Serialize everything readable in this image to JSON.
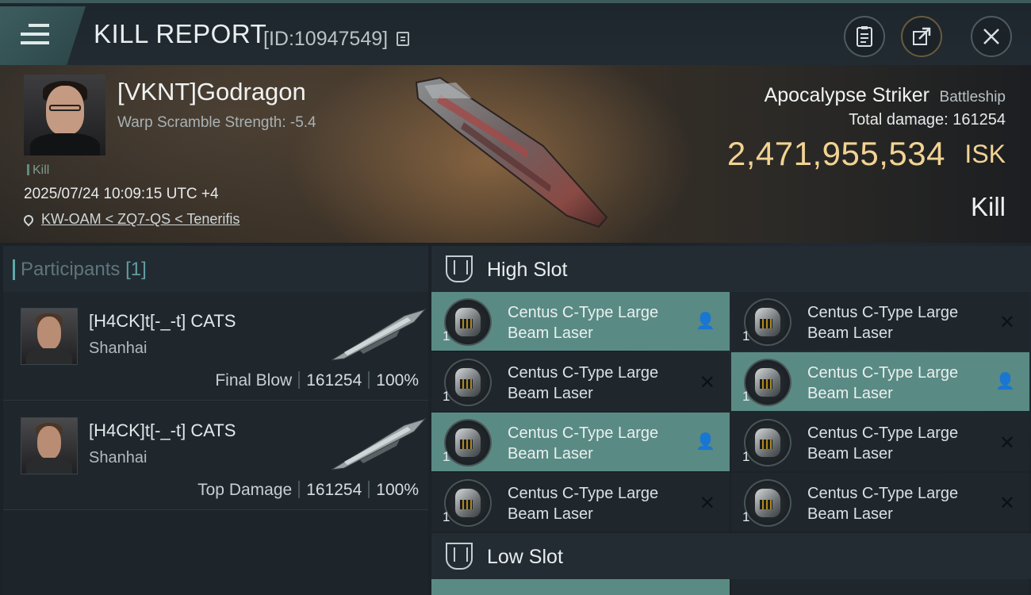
{
  "header": {
    "title": "KILL REPORT",
    "report_id": "[ID:10947549]"
  },
  "victim": {
    "name": "[VKNT]Godragon",
    "warp_scramble": "Warp Scramble Strength: -5.4",
    "type_tag": "Kill",
    "datetime": "2025/07/24 10:09:15 UTC +4",
    "location": "KW-OAM < ZQ7-QS < Tenerifis",
    "ship_name": "Apocalypse Striker",
    "ship_class": "Battleship",
    "total_damage": "Total damage:  161254",
    "isk_value": "2,471,955,534",
    "isk_unit": "ISK",
    "status": "Kill"
  },
  "participants": {
    "label": "Participants",
    "count": "[1]",
    "rows": [
      {
        "name": "[H4CK]t[-_-t] CATS",
        "corp": "Shanhai",
        "role": "Final Blow",
        "damage": "161254",
        "percent": "100%"
      },
      {
        "name": "[H4CK]t[-_-t] CATS",
        "corp": "Shanhai",
        "role": "Top Damage",
        "damage": "161254",
        "percent": "100%"
      }
    ]
  },
  "slots": {
    "high_label": "High Slot",
    "low_label": "Low Slot",
    "modules": [
      {
        "name_line1": "Centus C-Type Large",
        "name_line2": "Beam Laser",
        "qty": "1",
        "highlighted": true,
        "status_icon": "person-icon"
      },
      {
        "name_line1": "Centus C-Type Large",
        "name_line2": "Beam Laser",
        "qty": "1",
        "highlighted": false,
        "status_icon": "destroyed-x-icon"
      },
      {
        "name_line1": "Centus C-Type Large",
        "name_line2": "Beam Laser",
        "qty": "1",
        "highlighted": false,
        "status_icon": "destroyed-x-icon"
      },
      {
        "name_line1": "Centus C-Type Large",
        "name_line2": "Beam Laser",
        "qty": "1",
        "highlighted": true,
        "status_icon": "person-icon"
      },
      {
        "name_line1": "Centus C-Type Large",
        "name_line2": "Beam Laser",
        "qty": "1",
        "highlighted": true,
        "status_icon": "person-icon"
      },
      {
        "name_line1": "Centus C-Type Large",
        "name_line2": "Beam Laser",
        "qty": "1",
        "highlighted": false,
        "status_icon": "destroyed-x-icon"
      },
      {
        "name_line1": "Centus C-Type Large",
        "name_line2": "Beam Laser",
        "qty": "1",
        "highlighted": false,
        "status_icon": "destroyed-x-icon"
      },
      {
        "name_line1": "Centus C-Type Large",
        "name_line2": "Beam Laser",
        "qty": "1",
        "highlighted": false,
        "status_icon": "destroyed-x-icon"
      }
    ]
  },
  "colors": {
    "accent": "#5fa7a8",
    "highlight_slot": "#5a8a84",
    "isk_gold": "#f1d393"
  },
  "icons": {
    "menu": "menu-icon",
    "clipboard": "clipboard-icon",
    "share": "share-icon",
    "close": "close-icon",
    "x_mark": "✕",
    "person": "👤"
  }
}
